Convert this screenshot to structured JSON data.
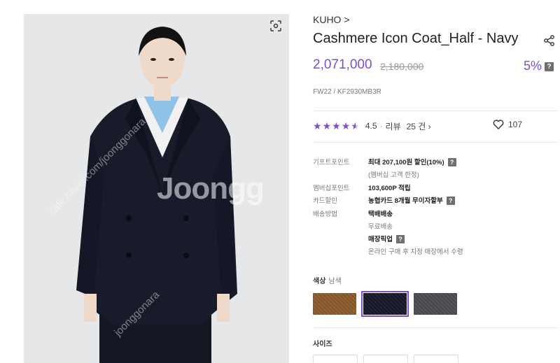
{
  "product": {
    "brand": "KUHO >",
    "title": "Cashmere Icon Coat_Half - Navy",
    "price": "2,071,000",
    "original_price": "2,180,000",
    "discount": "5%",
    "model_code": "FW22 / KF2930MB3R",
    "rating": "4.5",
    "review_label": "리뷰",
    "review_count": "25 건 ›",
    "likes": "107",
    "accent_color": "#7f4cd6"
  },
  "image": {
    "watermark": "Joongg",
    "diag_watermark_1": "cafe.naver.com/joonggonara",
    "diag_watermark_2": "joonggonara"
  },
  "benefits": {
    "gift_label": "기프트포인트",
    "gift_value": "최대 207,100원 할인(10%)",
    "gift_note": "(멤버십 고객 한정)",
    "member_label": "멤버십포인트",
    "member_value": "103,600P 적립",
    "card_label": "카드할인",
    "card_value": "농협카드 8개월 무이자할부",
    "ship_label": "배송방법",
    "ship_value": "택배배송",
    "ship_note": "무료배송",
    "pickup_value": "매장픽업",
    "pickup_note": "온라인 구매 후 지정 매장에서 수령"
  },
  "options": {
    "color_label": "색상",
    "color_selected": "남색",
    "size_label": "사이즈",
    "swatches": [
      "#8a5a2b",
      "#15172a",
      "#4a4b4f"
    ]
  },
  "icons": {
    "zoom": "zoom-icon",
    "share": "share-icon",
    "heart": "heart-icon",
    "help": "?"
  }
}
